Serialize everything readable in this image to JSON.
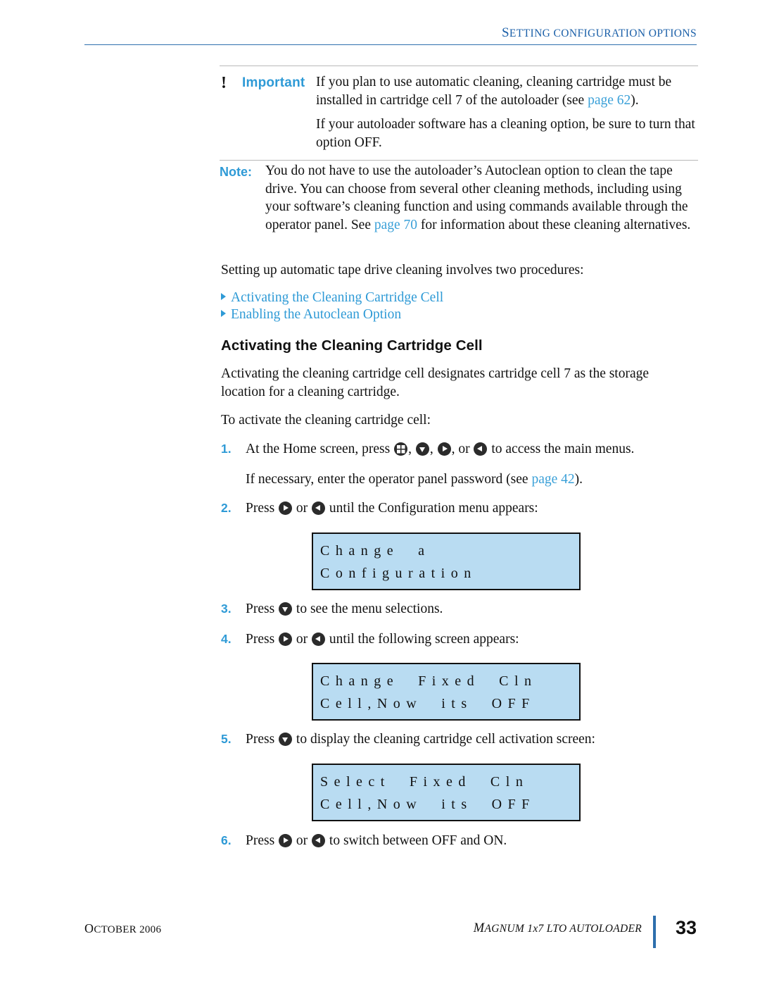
{
  "header": {
    "running_head_small_caps": "S",
    "running_head": "ETTING CONFIGURATION OPTIONS",
    "running_head_full": "SETTING CONFIGURATION OPTIONS"
  },
  "important": {
    "bang": "!",
    "label": "Important",
    "paragraph1_a": "If you plan to use automatic cleaning, cleaning cartridge must be installed in cartridge cell 7 of the autoloader (see ",
    "paragraph1_link": "page 62",
    "paragraph1_b": ").",
    "paragraph2": "If your autoloader software has a cleaning option, be sure to turn that option OFF."
  },
  "note": {
    "label": "Note:",
    "text_a": "You do not have to use the autoloader’s Autoclean option to clean the tape drive. You can choose from several other cleaning methods, including using your software’s cleaning function and using commands available through the operator panel. See ",
    "link": "page 70",
    "text_b": " for information about these cleaning alternatives."
  },
  "intro_paragraph": "Setting up automatic tape drive cleaning involves two procedures:",
  "bullets": [
    "Activating the Cleaning Cartridge Cell",
    "Enabling the Autoclean Option"
  ],
  "section_heading": "Activating the Cleaning Cartridge Cell",
  "section_paragraph": "Activating the cleaning cartridge cell designates cartridge cell 7 as the storage location for a cleaning cartridge.",
  "section_lead_in": "To activate the cleaning cartridge cell:",
  "steps": [
    {
      "number": "1.",
      "text_a": "At the Home screen, press ",
      "text_b": ", ",
      "text_c": ", ",
      "text_d": ", or ",
      "text_e": " to access the main menus.",
      "icons": [
        "grid-key-icon",
        "down-key-icon",
        "right-key-icon",
        "left-key-icon"
      ]
    },
    {
      "number": "",
      "text_a": "If necessary, enter the operator panel password (see ",
      "link": "page 42",
      "text_b": ")."
    },
    {
      "number": "2.",
      "text_a": "Press ",
      "text_b": " or ",
      "text_c": " until the Configuration menu appears:"
    },
    {
      "number": "3.",
      "text_a": "Press ",
      "text_b": " to see the menu selections."
    },
    {
      "number": "4.",
      "text_a": "Press ",
      "text_b": " or ",
      "text_c": " until the following screen appears:"
    },
    {
      "number": "5.",
      "text_a": "Press ",
      "text_b": " to display the cleaning cartridge cell activation screen:"
    },
    {
      "number": "6.",
      "text_a": "Press ",
      "text_b": " or ",
      "text_c": " to switch between OFF and ON."
    }
  ],
  "lcd_screens": [
    {
      "line1": "Change  a",
      "line2": "Configuration"
    },
    {
      "line1": "Change  Fixed  Cln",
      "line2": "Cell,Now  its  OFF"
    },
    {
      "line1": "Select  Fixed  Cln",
      "line2": "Cell,Now  its  OFF"
    }
  ],
  "footer": {
    "date_caps": "O",
    "date": "CTOBER 2006",
    "date_full": "OCTOBER 2006",
    "product_caps": "M",
    "product": "AGNUM 1x7 LTO AUTOLOADER",
    "product_full": "MAGNUM 1x7 LTO AUTOLOADER",
    "page_number": "33"
  },
  "colors": {
    "accent_blue": "#2e9ad6",
    "header_blue": "#1a5fa8",
    "rule_blue": "#2e6fad",
    "lcd_background": "#b9dcf2"
  }
}
